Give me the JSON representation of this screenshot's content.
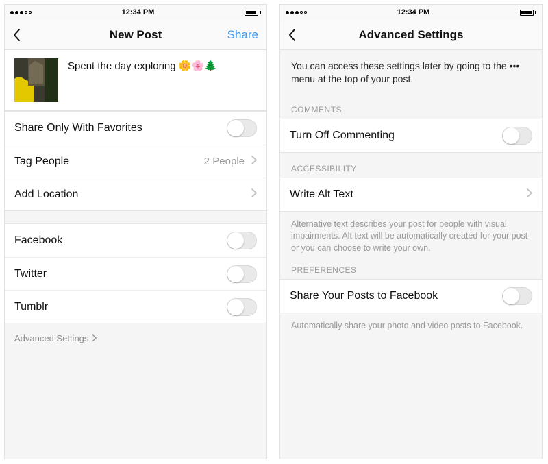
{
  "status": {
    "time": "12:34 PM"
  },
  "left": {
    "nav": {
      "title": "New Post",
      "share": "Share"
    },
    "caption": "Spent the day exploring 🌼🌸🌲",
    "rows": {
      "favorites": "Share Only With Favorites",
      "tag": "Tag People",
      "tag_meta": "2 People",
      "location": "Add Location"
    },
    "share_to": {
      "facebook": "Facebook",
      "twitter": "Twitter",
      "tumblr": "Tumblr"
    },
    "advanced_link": "Advanced Settings"
  },
  "right": {
    "nav": {
      "title": "Advanced Settings"
    },
    "info": "You can access these settings later by going to the ••• menu at the top of your post.",
    "sections": {
      "comments": "COMMENTS",
      "accessibility": "ACCESSIBILITY",
      "preferences": "PREFERENCES"
    },
    "rows": {
      "turn_off_commenting": "Turn Off Commenting",
      "alt_text": "Write Alt Text",
      "share_fb": "Share Your Posts to Facebook"
    },
    "hints": {
      "alt": "Alternative text describes your post for people with visual impairments. Alt text will be automatically created for your post or you can choose to write your own.",
      "fb": "Automatically share your photo and video posts to Facebook."
    }
  }
}
